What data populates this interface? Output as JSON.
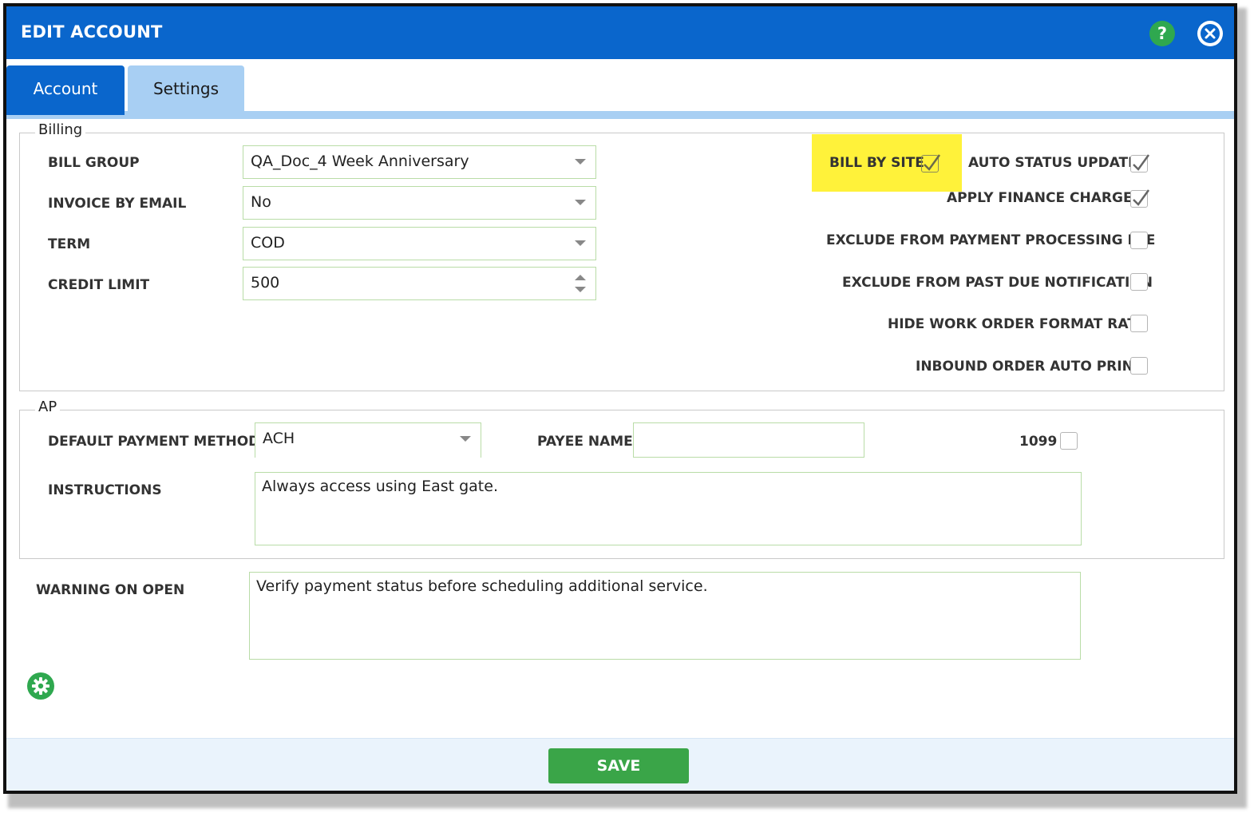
{
  "window": {
    "title": "EDIT ACCOUNT",
    "help_label": "?"
  },
  "tabs": [
    {
      "label": "Account",
      "active": true
    },
    {
      "label": "Settings",
      "active": false
    }
  ],
  "billing": {
    "legend": "Billing",
    "bill_group": {
      "label": "BILL GROUP",
      "value": "QA_Doc_4 Week Anniversary"
    },
    "invoice_by_email": {
      "label": "INVOICE BY EMAIL",
      "value": "No"
    },
    "term": {
      "label": "TERM",
      "value": "COD"
    },
    "credit_limit": {
      "label": "CREDIT LIMIT",
      "value": "500"
    },
    "checkboxes": [
      {
        "label": "BILL BY SITE",
        "checked": true
      },
      {
        "label": "AUTO STATUS UPDATE",
        "checked": true
      },
      {
        "label": "APPLY FINANCE CHARGES",
        "checked": true
      },
      {
        "label": "EXCLUDE FROM PAYMENT PROCESSING FEE",
        "checked": false
      },
      {
        "label": "EXCLUDE FROM PAST DUE NOTIFICATION",
        "checked": false
      },
      {
        "label": "HIDE WORK ORDER FORMAT RATE",
        "checked": false
      },
      {
        "label": "INBOUND ORDER AUTO PRINT",
        "checked": false
      }
    ]
  },
  "ap": {
    "legend": "AP",
    "default_payment_method": {
      "label": "DEFAULT PAYMENT METHOD",
      "value": "ACH"
    },
    "payee_name": {
      "label": "PAYEE NAME",
      "value": ""
    },
    "form_1099": {
      "label": "1099",
      "checked": false
    },
    "instructions": {
      "label": "INSTRUCTIONS",
      "value": "Always access using East gate."
    }
  },
  "warning_on_open": {
    "label": "WARNING ON OPEN",
    "value": "Verify payment status before scheduling additional service."
  },
  "footer": {
    "save_label": "SAVE"
  },
  "colors": {
    "header": "#0a66cc",
    "tab_inactive": "#a8cff3",
    "accent_green": "#3aa548",
    "highlight": "#fff23a"
  },
  "icons": {
    "help": "question-circle-icon",
    "close": "close-circle-icon",
    "settings": "gear-icon",
    "check": "checkmark-icon",
    "dropdown": "chevron-down-icon"
  }
}
